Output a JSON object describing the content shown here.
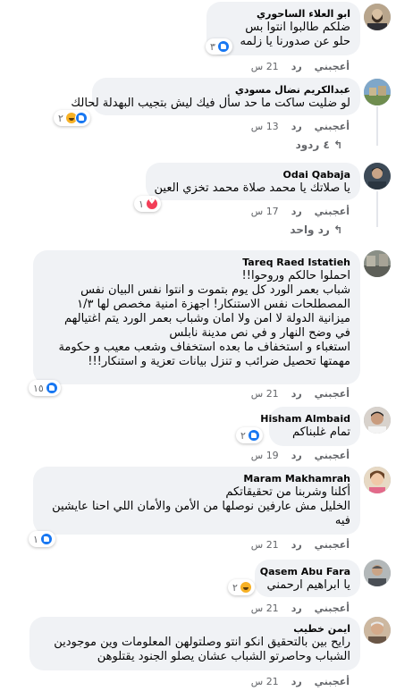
{
  "comments": [
    {
      "name": "ابو العلاء الساحوري",
      "lines": [
        "ضلكم طالبوا انتوا بس",
        "حلو عن صدورنا يا زلمه"
      ],
      "reaction_count": "٣",
      "reactions": [
        "like-icon"
      ],
      "like_label": "أعجبني",
      "reply_label": "رد",
      "time": "21 س",
      "avatar": "avatar-man-beard"
    },
    {
      "name": "عبدالكريم نضال مسودي",
      "lines": [
        "لو ضليت ساكت ما حد سأل فيك ليش بتجيب البهدلة لحالك"
      ],
      "reaction_count": "٢",
      "reactions": [
        "like-icon",
        "haha-icon"
      ],
      "like_label": "أعجبني",
      "reply_label": "رد",
      "time": "13 س",
      "replies_label": "٤ ردود",
      "avatar": "avatar-landscape"
    },
    {
      "name": "Odai Qabaja",
      "lines": [
        "يا صلاتك يا محمد صلاة محمد تخزي العين"
      ],
      "reaction_count": "١",
      "reactions": [
        "love-icon"
      ],
      "like_label": "أعجبني",
      "reply_label": "رد",
      "time": "17 س",
      "replies_label": "رد واحد",
      "avatar": "avatar-man-dark"
    },
    {
      "name": "Tareq Raed Istatieh",
      "lines": [
        "احملوا حالكم وروحوا!!",
        "شباب بعمر الورد كل يوم بتموت و انتوا نفس البيان نفس",
        "المصطلحات نفس الاستنكار! اجهزة امنية مخصص لها ١/٣",
        "ميزانية الدولة لا امن ولا امان وشباب بعمر الورد يتم اغتيالهم",
        "في وضح النهار و في نص مدينة نابلس",
        "استغباء و استخفاف ما بعده استخفاف وشعب معيب و حكومة",
        "مهمتها تحصيل ضرائب و تنزل بيانات تعزية و استنكار!!!"
      ],
      "reaction_count": "١٥",
      "reactions": [
        "like-icon"
      ],
      "like_label": "أعجبني",
      "reply_label": "رد",
      "time": "21 س",
      "avatar": "avatar-street"
    },
    {
      "name": "Hisham Almbaid",
      "lines": [
        "تمام غلبناكم"
      ],
      "reaction_count": "٢",
      "reactions": [
        "like-icon"
      ],
      "like_label": "أعجبني",
      "reply_label": "رد",
      "time": "19 س",
      "avatar": "avatar-man-light"
    },
    {
      "name": "Maram Makhamrah",
      "lines": [
        "أكلنا وشربنا من تحقيقاتكم",
        "الخليل مش عارفين نوصلها من الأمن والأمان اللي احنا عايشين",
        "فيه"
      ],
      "reaction_count": "١",
      "reactions": [
        "like-icon"
      ],
      "like_label": "أعجبني",
      "reply_label": "رد",
      "time": "21 س",
      "avatar": "avatar-child"
    },
    {
      "name": "Qasem Abu Fara",
      "lines": [
        "يا ابراهيم ارحمني"
      ],
      "reaction_count": "٢",
      "reactions": [
        "haha-icon"
      ],
      "like_label": "أعجبني",
      "reply_label": "رد",
      "time": "21 س",
      "avatar": "avatar-man-grey"
    },
    {
      "name": "ايمن خطيب",
      "lines": [
        "رايح بين بالتحقيق انكو انتو وصلتولهن المعلومات وين موجودين",
        "الشباب وحاصرتو الشباب عشان يصلو الجنود يقتلوهن"
      ],
      "like_label": "أعجبني",
      "reply_label": "رد",
      "time": "21 س",
      "avatar": "avatar-elder"
    }
  ],
  "colors": {
    "bubble": "#f0f2f5",
    "meta": "#65676b",
    "like": "#1877f2",
    "love": "#f33e58",
    "haha": "#f7b125"
  }
}
